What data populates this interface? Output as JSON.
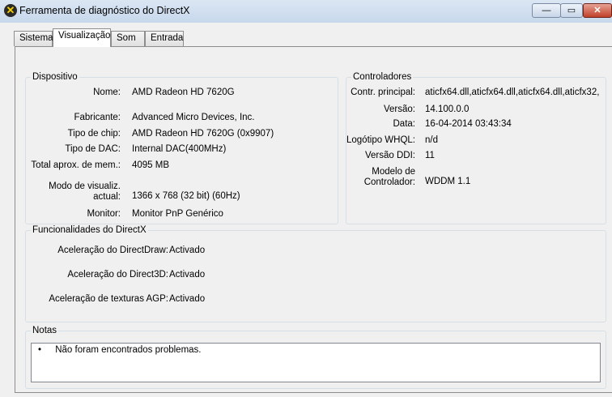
{
  "window": {
    "title": "Ferramenta de diagnóstico do DirectX",
    "minimize": "—",
    "maximize": "▭",
    "close": "✕"
  },
  "tabs": [
    "Sistema",
    "Visualização",
    "Som",
    "Entrada"
  ],
  "device": {
    "title": "Dispositivo",
    "rows": [
      {
        "label": "Nome:",
        "value": "AMD Radeon HD 7620G"
      },
      {
        "label": "Fabricante:",
        "value": "Advanced Micro Devices, Inc."
      },
      {
        "label": "Tipo de chip:",
        "value": "AMD Radeon HD 7620G (0x9907)"
      },
      {
        "label": "Tipo de DAC:",
        "value": "Internal DAC(400MHz)"
      },
      {
        "label": "Total aprox. de mem.:",
        "value": "4095 MB"
      },
      {
        "label": "Modo de visualiz.",
        "label2": "actual:",
        "value": "1366 x 768 (32 bit) (60Hz)"
      },
      {
        "label": "Monitor:",
        "value": "Monitor PnP Genérico"
      }
    ]
  },
  "drivers": {
    "title": "Controladores",
    "rows": [
      {
        "label": "Contr. principal:",
        "value": "aticfx64.dll,aticfx64.dll,aticfx64.dll,aticfx32,"
      },
      {
        "label": "Versão:",
        "value": "14.100.0.0"
      },
      {
        "label": "Data:",
        "value": "16-04-2014 03:43:34"
      },
      {
        "label": "Logótipo WHQL:",
        "value": "n/d"
      },
      {
        "label": "Versão DDI:",
        "value": "11"
      },
      {
        "label": "Modelo de",
        "label2": "Controlador:",
        "value": "WDDM 1.1"
      }
    ]
  },
  "features": {
    "title": "Funcionalidades do DirectX",
    "rows": [
      {
        "label": "Aceleração do DirectDraw:",
        "value": "Activado"
      },
      {
        "label": "Aceleração do Direct3D:",
        "value": "Activado"
      },
      {
        "label": "Aceleração de texturas AGP:",
        "value": "Activado"
      }
    ]
  },
  "notes": {
    "title": "Notas",
    "bullet": "•",
    "items": [
      "Não foram encontrados problemas."
    ]
  }
}
